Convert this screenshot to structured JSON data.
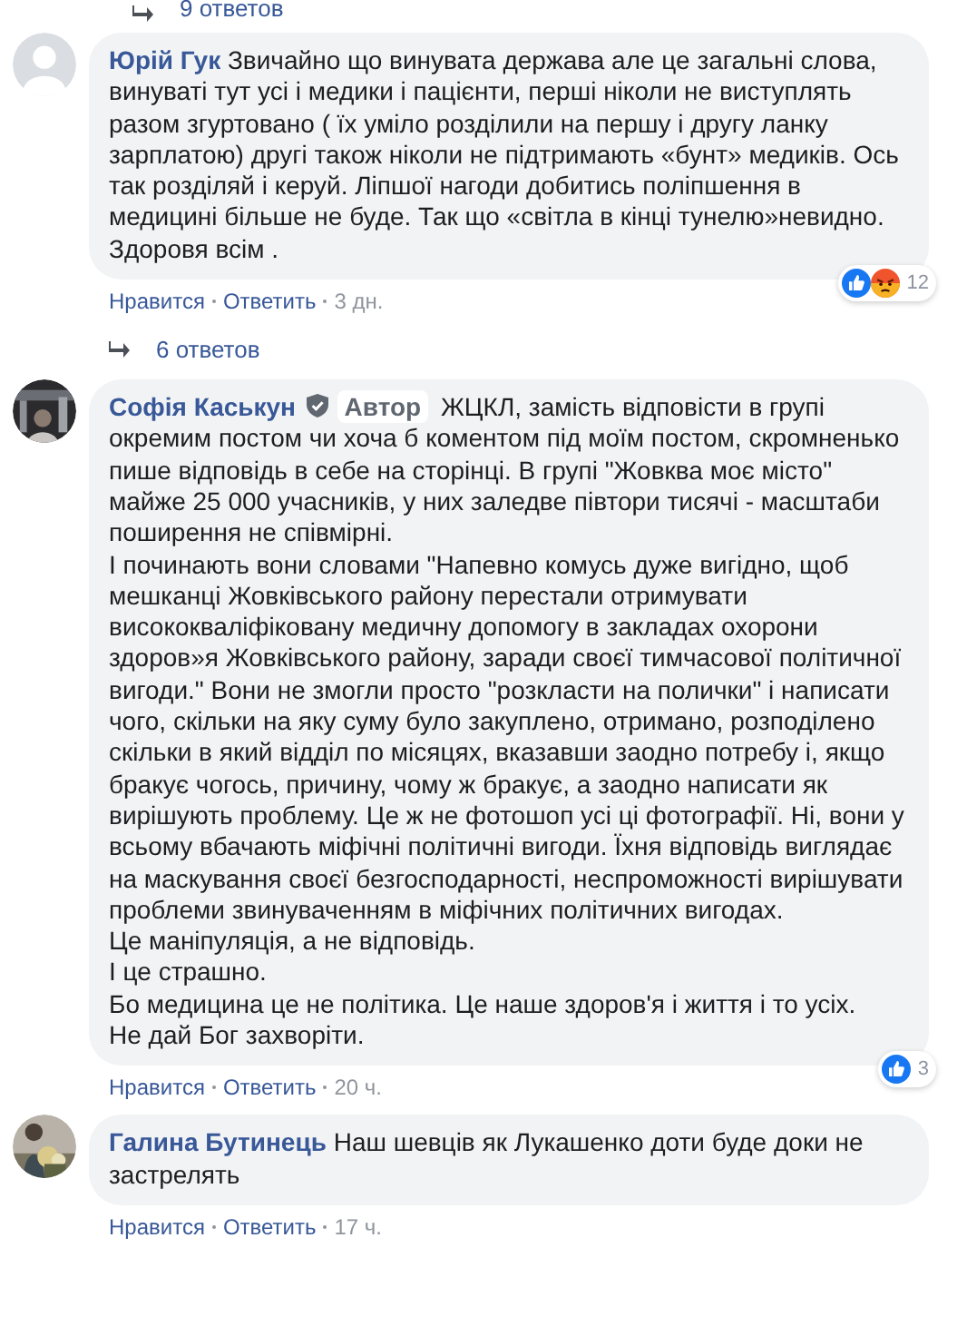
{
  "top_replies": {
    "label": "9 ответов"
  },
  "comments": [
    {
      "avatar": {
        "kind": "silhouette"
      },
      "author": "Юрій Гук",
      "text": "Звичайно що винувата держава але це загальні слова, винуваті тут усі і медики і пацієнти, перші ніколи не виступлять разом згуртовано ( їх уміло розділили на першу і другу ланку зарплатою) другі також ніколи не підтримають «бунт» медиків. Ось так розділяй і керуй. Ліпшої нагоди добитись поліпшення в медицині більше не буде. Так що «світла в кінці тунелю»невидно.\nЗдоровя всім .",
      "reactions": {
        "like": true,
        "angry": true,
        "count": "12"
      },
      "like": "Нравится",
      "reply": "Ответить",
      "time": "3 дн.",
      "replies": "6 ответов"
    },
    {
      "author": "Софія Каськун",
      "verified": true,
      "badge": "Автор",
      "text": "ЖЦКЛ, замість відповісти в групі окремим постом чи хоча б коментом під моїм постом, скромненько пише відповідь в себе на сторінці. В групі \"Жовква моє місто\" майже 25 000 учасників, у них заледве півтори тисячі - масштаби поширення не співмірні.\nІ починають вони словами \"Напевно комусь дуже вигідно, щоб мешканці Жовківського району перестали отримувати висококваліфіковану медичну допомогу в закладах охорони здоров»я Жовківського району, заради своєї тимчасової політичної вигоди.\" Вони не змогли просто \"розкласти на полички\" і написати чого, скільки на яку суму було закуплено, отримано, розподілено скільки в який відділ по місяцях, вказавши заодно потребу і, якщо бракує чогось, причину, чому ж бракує, а заодно написати як вирішують проблему. Це ж не фотошоп усі ці фотографії. Ні, вони у всьому вбачають міфічні політичні вигоди. Їхня відповідь виглядає на маскування своєї безгосподарності, неспроможності вирішувати проблеми звинуваченням в міфічних політичних вигодах.\nЦе маніпуляція, а не відповідь.\nІ це страшно.\nБо медицина це не політика. Це наше здоров'я і життя і то усіх.\nНе дай Бог захворіти.",
      "reactions": {
        "like": true,
        "angry": false,
        "count": "3"
      },
      "like": "Нравится",
      "reply": "Ответить",
      "time": "20 ч."
    },
    {
      "author": "Галина Бутинець",
      "text": "Наш шевців як Лукашенко доти буде доки не застрелять",
      "like": "Нравится",
      "reply": "Ответить",
      "time": "17 ч."
    }
  ]
}
